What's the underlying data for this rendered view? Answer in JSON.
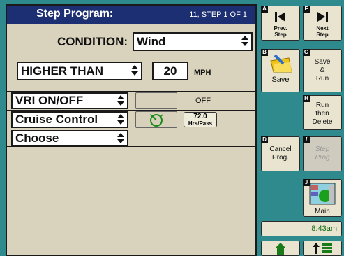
{
  "header": {
    "title": "Step Program:",
    "step_info": "11, STEP  1  OF  1"
  },
  "condition": {
    "label": "CONDITION:",
    "value": "Wind"
  },
  "comparator": {
    "value": "HIGHER THAN",
    "threshold": "20",
    "unit": "MPH"
  },
  "actions": [
    {
      "name": "VRI ON/OFF",
      "state": "OFF"
    },
    {
      "name": "Cruise Control",
      "rate": "72.0",
      "rate_unit": "Hrs/Pass"
    },
    {
      "name": "Choose"
    }
  ],
  "softkeys": {
    "prev_step": {
      "key": "A",
      "label": "Prev.\nStep"
    },
    "next_step": {
      "key": "F",
      "label": "Next\nStep"
    },
    "save": {
      "key": "B",
      "label": "Save"
    },
    "save_run": {
      "key": "G",
      "label": "Save\n&\nRun"
    },
    "run_delete": {
      "key": "H",
      "label": "Run\nthen\nDelete"
    },
    "cancel_prog": {
      "key": "D",
      "label": "Cancel\nProg."
    },
    "step_prog": {
      "key": "I",
      "label": "Step\nProg"
    },
    "main": {
      "key": "J",
      "label": "Main"
    }
  },
  "clock": "8:43am",
  "colors": {
    "background": "#2f8a8d",
    "panel": "#d9d3bd",
    "header": "#1d2f73",
    "clock_text": "#0d6a0d"
  }
}
